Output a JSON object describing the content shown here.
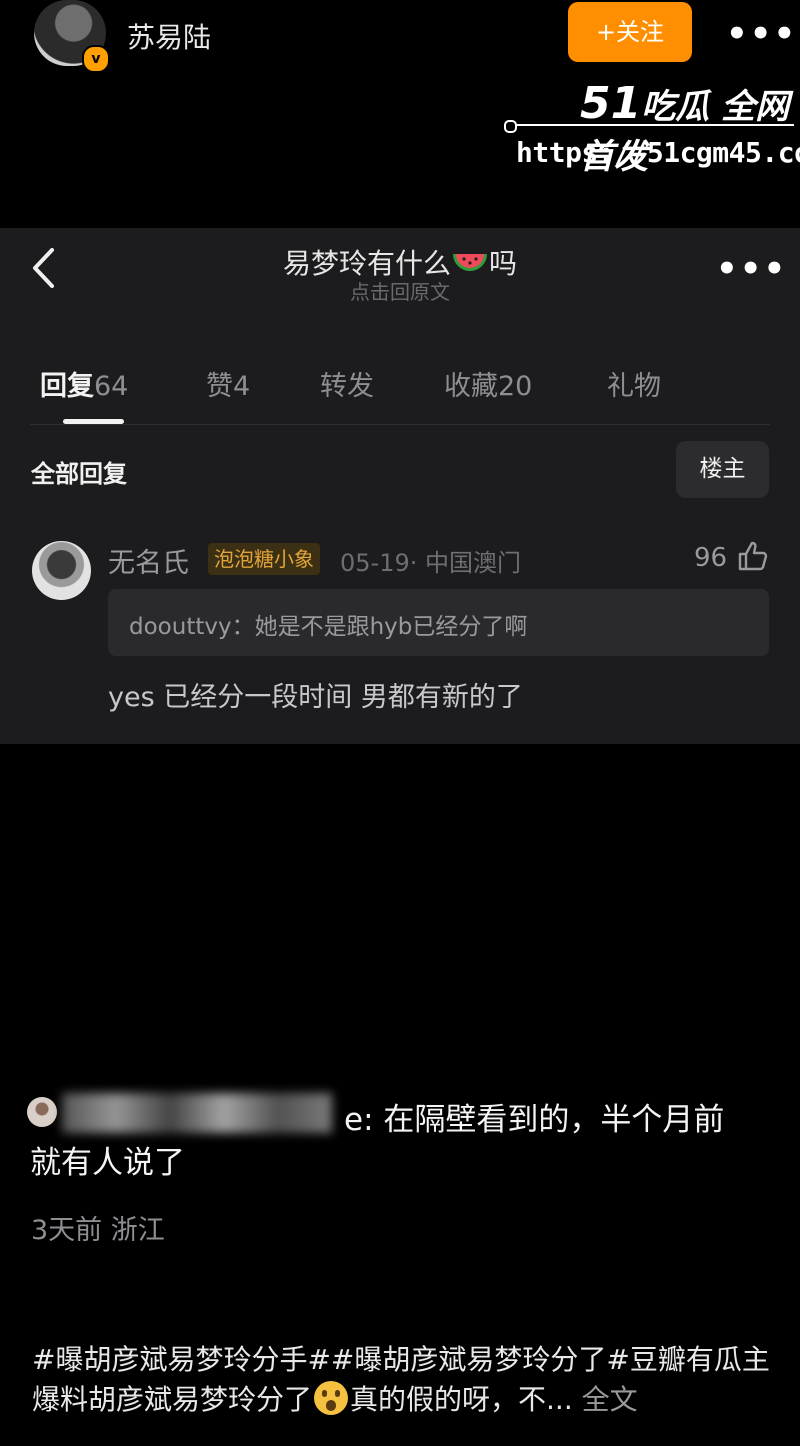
{
  "header": {
    "author_name": "苏易陆",
    "follow_label": "+关注",
    "more": "•••"
  },
  "watermark": {
    "brand_num": "51",
    "brand_text": "吃瓜 全网首发",
    "url": "https://51cgm45.com"
  },
  "panel": {
    "title": "易梦玲有什么",
    "title_suffix": "吗",
    "subtitle": "点击回原文",
    "more": "•••",
    "tabs": [
      {
        "label": "回复",
        "count": "64"
      },
      {
        "label": "赞",
        "count": "4"
      },
      {
        "label": "转发",
        "count": ""
      },
      {
        "label": "收藏",
        "count": "20"
      },
      {
        "label": "礼物",
        "count": ""
      }
    ],
    "all_replies_label": "全部回复",
    "op_button_label": "楼主",
    "reply": {
      "user": "无名氏",
      "badge": "泡泡糖小象",
      "meta": "05-19· 中国澳门",
      "likes": "96",
      "quote": "doouttvy：她是不是跟hyb已经分了啊",
      "text": "yes 已经分一段时间 男都有新的了"
    }
  },
  "repost": {
    "line1": "e: 在隔壁看到的，半个月前",
    "line2": "就有人说了",
    "meta": "3天前 浙江"
  },
  "caption": {
    "hashtags": "#曝胡彦斌易梦玲分手##曝胡彦斌易梦玲分了#豆瓣有瓜主爆料胡彦斌易梦玲分了",
    "after_emoji": "真的假的呀，不...",
    "full_text_link": "全文"
  },
  "colors": {
    "accent_orange": "#ff8f00",
    "panel_bg": "#1c1c1e",
    "badge_text": "#e2a43a"
  },
  "icons": [
    "back-icon",
    "more-icon",
    "like-icon",
    "verified-icon",
    "watermelon-icon",
    "shocked-emoji-icon"
  ]
}
